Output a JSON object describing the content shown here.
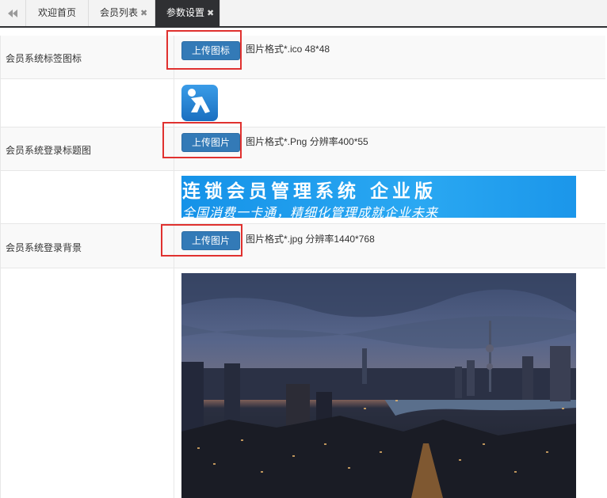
{
  "tabs": [
    {
      "label": "欢迎首页",
      "closable": false,
      "active": false
    },
    {
      "label": "会员列表",
      "closable": true,
      "active": false
    },
    {
      "label": "参数设置",
      "closable": true,
      "active": true
    }
  ],
  "tab_close_glyph": "✖",
  "rows": {
    "favicon": {
      "label": "会员系统标签图标",
      "button": "上传图标",
      "hint": "图片格式*.ico 48*48"
    },
    "login_title": {
      "label": "会员系统登录标题图",
      "button": "上传图片",
      "hint": "图片格式*.Png 分辨率400*55"
    },
    "login_background": {
      "label": "会员系统登录背景",
      "button": "上传图片",
      "hint": "图片格式*.jpg 分辨率1440*768"
    }
  },
  "banner": {
    "title": "连锁会员管理系统  企业版",
    "subtitle": "全国消费一卡通，精细化管理成就企业未来"
  },
  "colors": {
    "active_tab": "#2f3033",
    "button": "#337ab7",
    "highlight_box": "#e0312f",
    "banner": "#1b96ea"
  },
  "icons": {
    "back": "double-chevron-left-icon",
    "favicon_preview": "person-walking-icon"
  }
}
